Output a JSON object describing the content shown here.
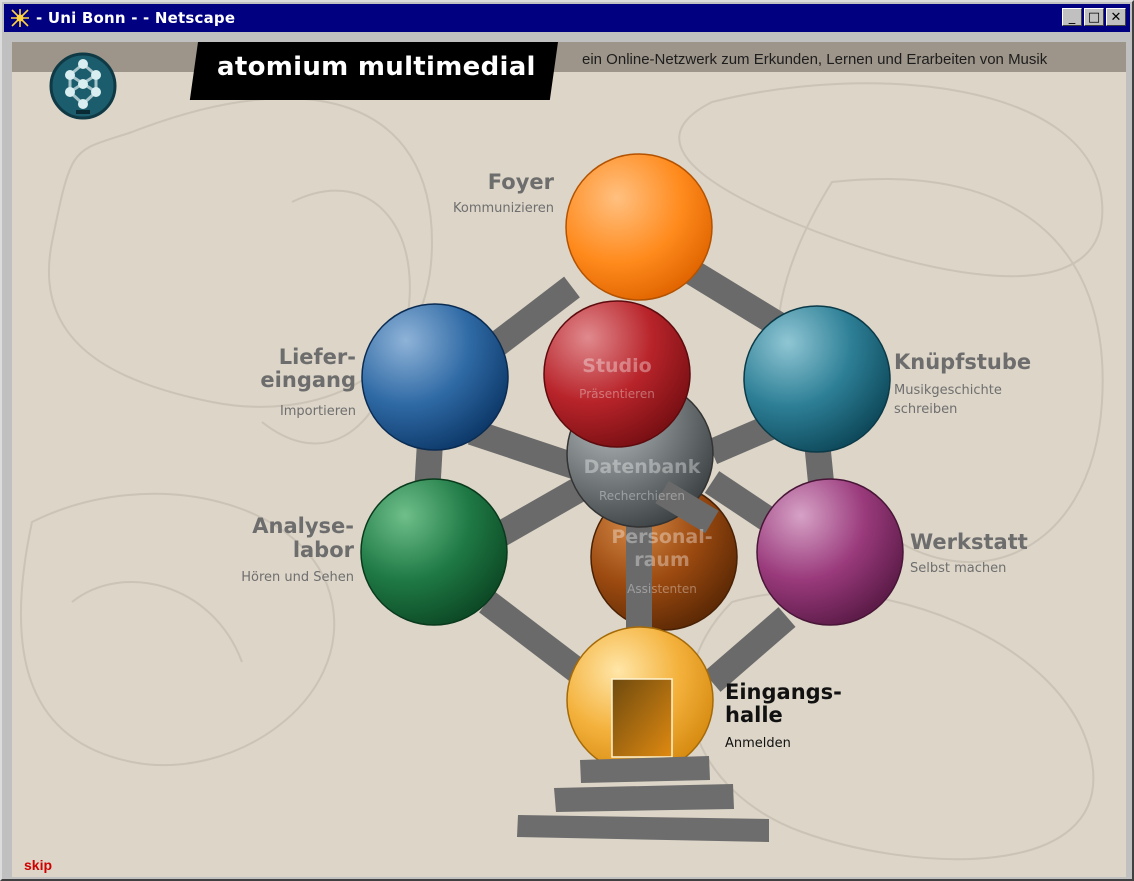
{
  "window": {
    "title": " - Uni Bonn - - Netscape",
    "controls": [
      "_",
      "□",
      "✕"
    ]
  },
  "header": {
    "brand": "atomium multimedial",
    "tagline": "ein Online-Netzwerk zum Erkunden, Lernen und Erarbeiten von Musik"
  },
  "rooms": {
    "foyer": {
      "title": "Foyer",
      "subtitle": "Kommunizieren",
      "color": "#ff8a1c"
    },
    "liefereingang": {
      "title_1": "Liefer-",
      "title_2": "eingang",
      "subtitle": "Importieren",
      "color": "#1e5d99"
    },
    "studio": {
      "title": "Studio",
      "subtitle": "Präsentieren",
      "color": "#b8242a"
    },
    "knuepfstube": {
      "title": "Knüpfstube",
      "subtitle_1": "Musikgeschichte",
      "subtitle_2": "schreiben",
      "color": "#1f6f85"
    },
    "datenbank": {
      "title": "Datenbank",
      "subtitle": "Recherchieren",
      "color": "#6f7577"
    },
    "analyselabor": {
      "title_1": "Analyse-",
      "title_2": "labor",
      "subtitle": "Hören und Sehen",
      "color": "#1f7a45"
    },
    "personalraum": {
      "title_1": "Personal-",
      "title_2": "raum",
      "subtitle": "Assistenten",
      "color": "#9c4a10"
    },
    "werkstatt": {
      "title": "Werkstatt",
      "subtitle": "Selbst machen",
      "color": "#9a3a7c"
    },
    "eingangshalle": {
      "title_1": "Eingangs-",
      "title_2": "halle",
      "subtitle": "Anmelden",
      "color": "#f4b23d"
    }
  },
  "footer": {
    "skip": "skip"
  }
}
